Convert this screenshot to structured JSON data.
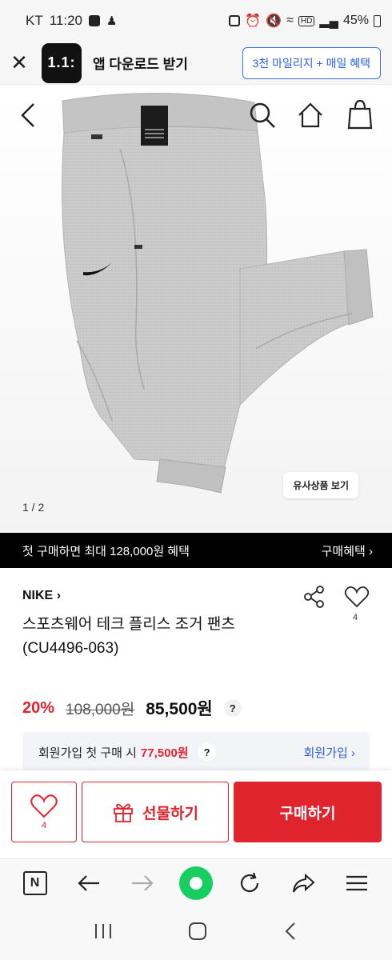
{
  "status_bar": {
    "carrier": "KT",
    "time": "11:20",
    "battery": "45%",
    "icons": [
      "checkbox-icon",
      "person-icon",
      "lock-icon",
      "alarm-icon",
      "mute-icon",
      "wifi-icon",
      "hd-icon",
      "signal-icon"
    ]
  },
  "app_banner": {
    "logo_text": "1.1:",
    "title": "앱 다운로드 받기",
    "cta": "3천 마일리지 + 매일 혜택"
  },
  "gallery": {
    "pager": "1 / 2",
    "similar_button": "유사상품 보기",
    "tag_lines": [
      "SLIM FIT",
      "COUPE AJUSTE",
      "REGULAR LENGTH"
    ],
    "logo_text": "NIKE"
  },
  "promo": {
    "text": "첫 구매하면 최대 128,000원 혜택",
    "link": "구매혜택"
  },
  "product": {
    "brand": "NIKE",
    "name": "스포츠웨어 테크 플리스 조거 팬츠 (CU4496-063)",
    "like_count": "4",
    "discount": "20%",
    "original_price": "108,000원",
    "sale_price": "85,500원"
  },
  "member_offer": {
    "prefix": "회원가입 첫 구매 시",
    "price": "77,500원",
    "link": "회원가입"
  },
  "actions": {
    "like_count": "4",
    "gift_label": "선물하기",
    "buy_label": "구매하기"
  },
  "colors": {
    "accent_red": "#e0242e",
    "link_blue": "#2b5fe8",
    "promo_bg": "#000000",
    "naver_green": "#19ce60"
  }
}
